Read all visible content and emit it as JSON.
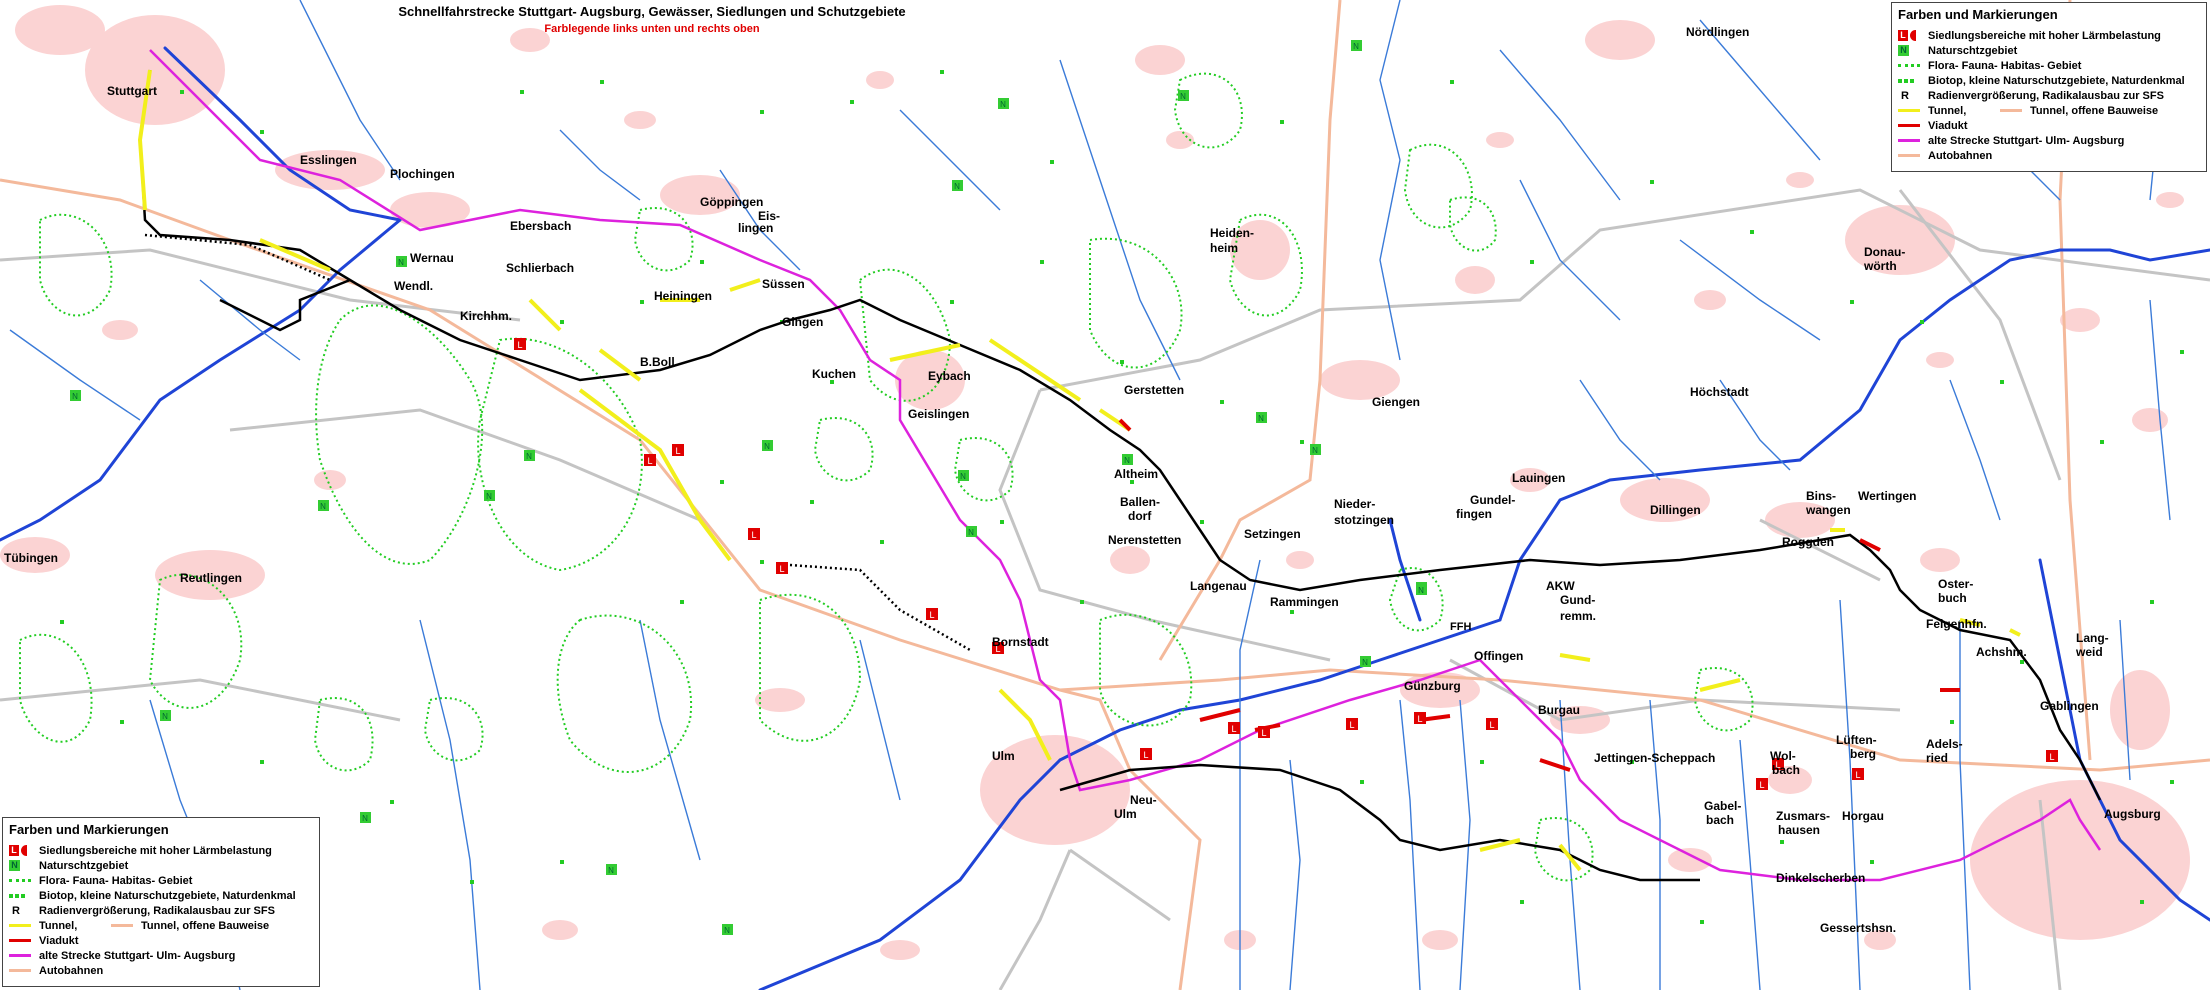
{
  "title": "Schnellfahrstrecke Stuttgart- Augsburg, Gewässer, Siedlungen und Schutzgebiete",
  "subtitle": "Farblegende links unten und rechts oben",
  "colors": {
    "settlement": "#fbd3d3",
    "river": "#1f44d6",
    "stream": "#3b7bd8",
    "highway": "#f4b99b",
    "road": "#bdbdbd",
    "new_line": "#000000",
    "tunnel": "#f2ef1c",
    "viaduct": "#e00000",
    "old_line": "#dd22dd",
    "protected": "#22cc22",
    "noise": "#e00000"
  },
  "legend": {
    "heading": "Farben und Markierungen",
    "items": [
      {
        "symbol": "L-noise-icon",
        "text": "Siedlungsbereiche mit hoher Lärmbelastung"
      },
      {
        "symbol": "N-reserve-icon",
        "text": "Naturschtzgebiet"
      },
      {
        "symbol": "dotted-green-line",
        "text": "Flora- Fauna- Habitas- Gebiet"
      },
      {
        "symbol": "green-dots",
        "text": "Biotop, kleine Naturschutzgebiete, Naturdenkmal"
      },
      {
        "symbol": "R",
        "text": "Radienvergrößerung, Radikalausbau zur SFS"
      },
      {
        "symbol": "yellow-line",
        "text": "Tunnel,",
        "extra_symbol": "salmon-line",
        "extra_text": "Tunnel, offene Bauweise"
      },
      {
        "symbol": "red-line",
        "text": "Viadukt"
      },
      {
        "symbol": "magenta-line",
        "text": "alte Strecke Stuttgart- Ulm- Augsburg"
      },
      {
        "symbol": "peach-line",
        "text": "Autobahnen"
      }
    ],
    "badge_L": "L",
    "badge_N": "N",
    "letter_R": "R"
  },
  "places": [
    {
      "name": "Stuttgart"
    },
    {
      "name": "Esslingen"
    },
    {
      "name": "Plochingen"
    },
    {
      "name": "Ebersbach"
    },
    {
      "name": "Göppingen"
    },
    {
      "name": "Eis-"
    },
    {
      "name": "lingen"
    },
    {
      "name": "Wernau"
    },
    {
      "name": "Schlierbach"
    },
    {
      "name": "Wendl."
    },
    {
      "name": "Kirchhm."
    },
    {
      "name": "Heiningen"
    },
    {
      "name": "Süssen"
    },
    {
      "name": "Gingen"
    },
    {
      "name": "B.Boll"
    },
    {
      "name": "Kuchen"
    },
    {
      "name": "Eybach"
    },
    {
      "name": "Geislingen"
    },
    {
      "name": "Tübingen"
    },
    {
      "name": "Reutlingen"
    },
    {
      "name": "Heiden-"
    },
    {
      "name": "heim"
    },
    {
      "name": "Gerstetten"
    },
    {
      "name": "Altheim"
    },
    {
      "name": "Ballen-"
    },
    {
      "name": "dorf"
    },
    {
      "name": "Nerenstetten"
    },
    {
      "name": "Setzingen"
    },
    {
      "name": "Langenau"
    },
    {
      "name": "Rammingen"
    },
    {
      "name": "Bornstadt"
    },
    {
      "name": "Ulm"
    },
    {
      "name": "Neu-"
    },
    {
      "name": "Ulm"
    },
    {
      "name": "Giengen"
    },
    {
      "name": "Nieder-"
    },
    {
      "name": "stotzingen"
    },
    {
      "name": "Gundel-"
    },
    {
      "name": "fingen"
    },
    {
      "name": "Lauingen"
    },
    {
      "name": "Dillingen"
    },
    {
      "name": "AKW"
    },
    {
      "name": "Gund-"
    },
    {
      "name": "remm."
    },
    {
      "name": "Offingen"
    },
    {
      "name": "Günzburg"
    },
    {
      "name": "Burgau"
    },
    {
      "name": "Jettingen-Scheppach"
    },
    {
      "name": "Nördlingen"
    },
    {
      "name": "Höchstadt"
    },
    {
      "name": "Donau-"
    },
    {
      "name": "wörth"
    },
    {
      "name": "Bins-"
    },
    {
      "name": "wangen"
    },
    {
      "name": "Wertingen"
    },
    {
      "name": "Roggden"
    },
    {
      "name": "Oster-"
    },
    {
      "name": "buch"
    },
    {
      "name": "Feigenhfn."
    },
    {
      "name": "Achshm."
    },
    {
      "name": "Lang-"
    },
    {
      "name": "weid"
    },
    {
      "name": "Gablingen"
    },
    {
      "name": "Wol-"
    },
    {
      "name": "bach"
    },
    {
      "name": "Lüften-"
    },
    {
      "name": "berg"
    },
    {
      "name": "Adels-"
    },
    {
      "name": "ried"
    },
    {
      "name": "Gabel-"
    },
    {
      "name": "bach"
    },
    {
      "name": "Zusmars-"
    },
    {
      "name": "hausen"
    },
    {
      "name": "Horgau"
    },
    {
      "name": "Augsburg"
    },
    {
      "name": "Dinkelscherben"
    },
    {
      "name": "Gessertshsn."
    },
    {
      "name": "FFH"
    }
  ],
  "markers": {
    "L": "L",
    "N": "N"
  }
}
